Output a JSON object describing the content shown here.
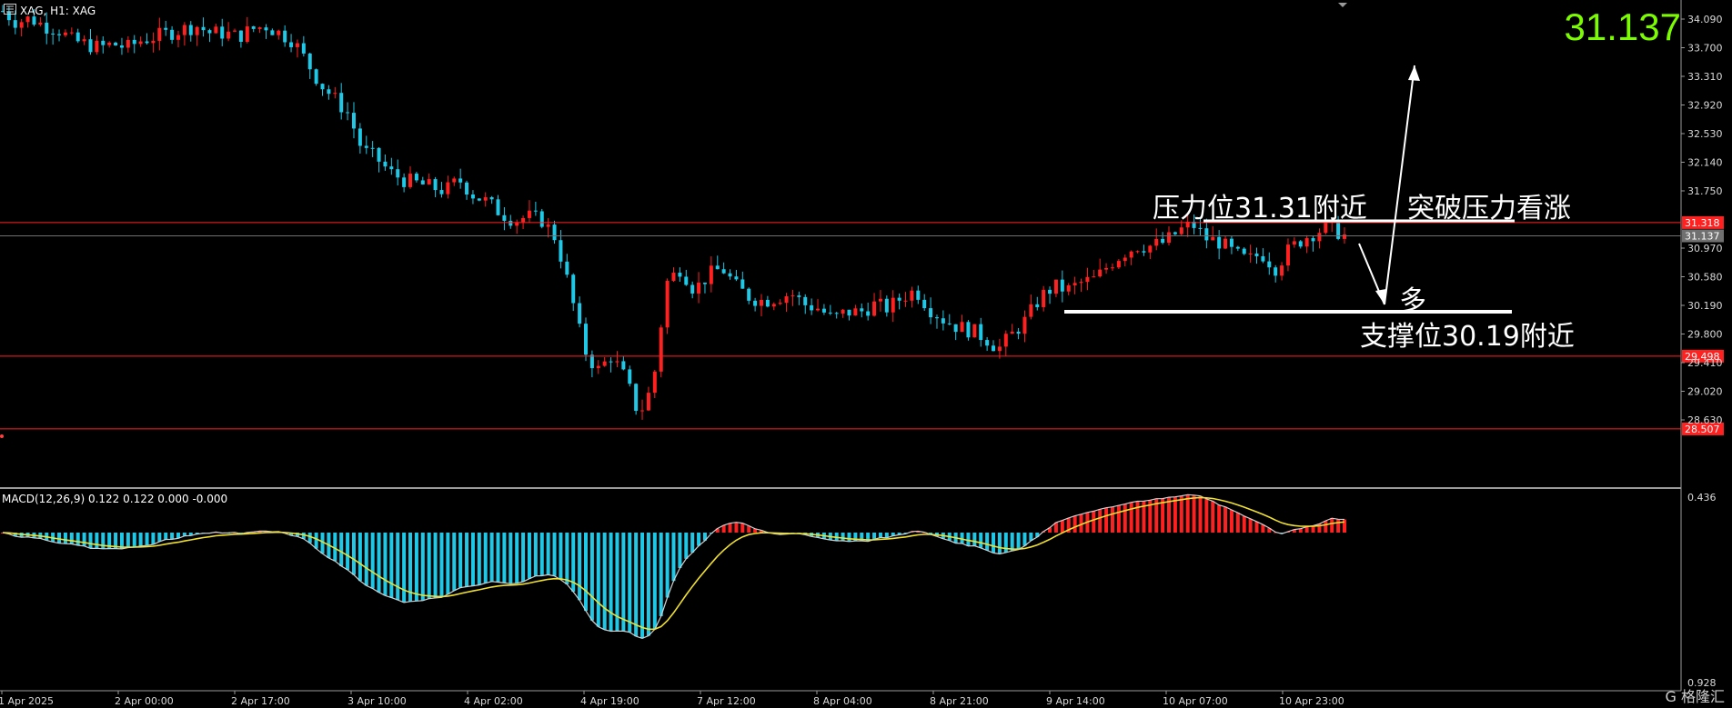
{
  "header": {
    "symbol_text": "XAG, H1:  XAG"
  },
  "current_price": "31.137",
  "price_axis": {
    "ticks": [
      "34.090",
      "33.700",
      "33.310",
      "32.920",
      "32.530",
      "32.140",
      "31.750",
      "30.970",
      "30.580",
      "30.190",
      "29.800",
      "29.410",
      "29.020",
      "28.630"
    ],
    "tags": [
      {
        "label": "31.318",
        "color": "#ff2020"
      },
      {
        "label": "31.137",
        "color": "#707070"
      },
      {
        "label": "29.498",
        "color": "#ff2020"
      },
      {
        "label": "28.507",
        "color": "#ff2020"
      }
    ]
  },
  "time_axis": {
    "labels": [
      "1 Apr 2025",
      "2 Apr 00:00",
      "2 Apr 17:00",
      "3 Apr 10:00",
      "4 Apr 02:00",
      "4 Apr 19:00",
      "7 Apr 12:00",
      "8 Apr 04:00",
      "8 Apr 21:00",
      "9 Apr 14:00",
      "10 Apr 07:00",
      "10 Apr 23:00"
    ]
  },
  "macd": {
    "label": "MACD(12,26,9) 0.122 0.122 0.000 -0.000",
    "axis_top": "0.436",
    "axis_bottom": "0.928"
  },
  "annotations": {
    "resistance": "压力位31.31附近",
    "breakout": "突破压力看涨",
    "bullish": "多",
    "support": "支撑位30.19附近"
  },
  "watermark": "G 格隆汇",
  "colors": {
    "up": "#ff2020",
    "down": "#1ec8e6",
    "signal": "#f0e030",
    "macd_line": "#d0d0d0",
    "price_green": "#7cfc00"
  },
  "chart_data": {
    "type": "candlestick",
    "symbol": "XAG",
    "timeframe": "H1",
    "close_path": [
      34.2,
      34.05,
      34.1,
      34.0,
      33.95,
      33.8,
      33.75,
      33.7,
      33.75,
      33.7,
      33.8,
      33.85,
      33.9,
      33.95,
      34.0,
      33.9,
      33.9,
      33.85,
      33.95,
      34.0,
      33.9,
      33.8,
      33.5,
      33.2,
      33.0,
      32.8,
      32.3,
      32.2,
      32.0,
      31.9,
      31.85,
      31.8,
      31.75,
      31.9,
      31.7,
      31.6,
      31.45,
      31.35,
      31.4,
      31.35,
      31.1,
      30.4,
      29.6,
      29.3,
      29.5,
      29.2,
      28.7,
      29.1,
      30.5,
      30.7,
      30.4,
      30.6,
      30.7,
      30.45,
      30.3,
      30.25,
      30.3,
      30.35,
      30.2,
      30.15,
      30.0,
      30.1,
      30.1,
      30.2,
      30.15,
      30.3,
      30.4,
      30.15,
      30.0,
      29.9,
      29.85,
      29.75,
      29.6,
      29.8,
      30.0,
      30.3,
      30.45,
      30.4,
      30.5,
      30.55,
      30.75,
      30.9,
      31.0,
      31.0,
      31.05,
      31.2,
      31.3,
      31.1,
      31.05,
      30.9,
      30.8,
      30.9,
      30.7,
      30.95,
      31.1,
      31.2,
      31.25,
      31.14
    ],
    "levels": [
      31.318,
      29.498,
      28.507
    ],
    "lines": [
      30.19,
      31.31
    ]
  }
}
